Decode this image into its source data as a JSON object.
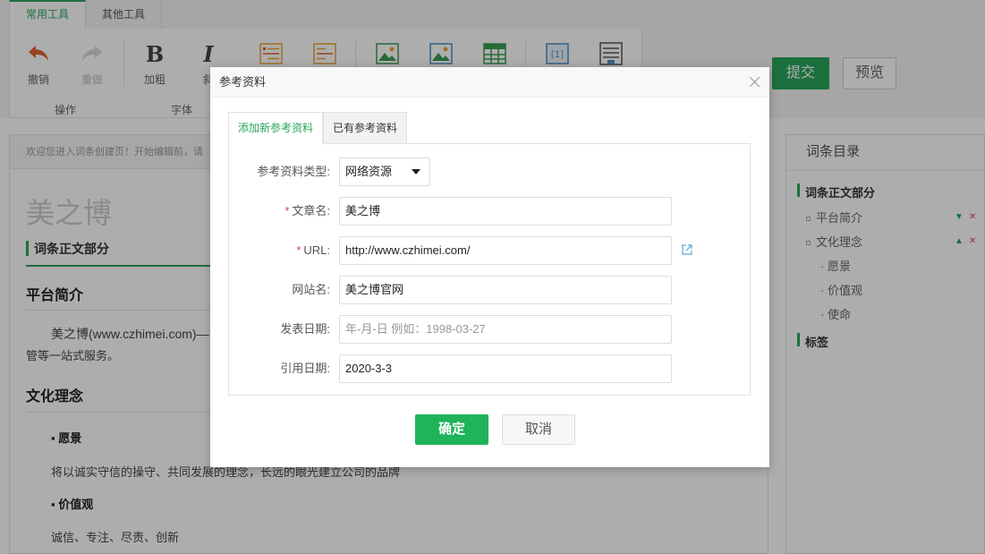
{
  "top_tabs": [
    "常用工具",
    "其他工具"
  ],
  "toolbar": {
    "undo": "撤销",
    "redo": "重做",
    "bold": "加粗",
    "italic_partial": "斜",
    "groups": {
      "operation": "操作",
      "font": "字体"
    }
  },
  "actions": {
    "submit": "提交",
    "preview": "预览"
  },
  "editor": {
    "notice": "欢迎您进入词条创建页！开始编辑前，请",
    "title": "美之博",
    "section": "词条正文部分",
    "h_platform": "平台简介",
    "platform_text_1": "美之博(www.czhimei.com)—",
    "platform_text_2": "管等一站式服务。",
    "h_culture": "文化理念",
    "sub_vision": "愿景",
    "vision_text": "将以诚实守信的操守、共同发展的理念，长远的眼光建立公司的品牌",
    "sub_values": "价值观",
    "values_text": "诚信、专注、尽责、创新"
  },
  "toc": {
    "title": "词条目录",
    "section_main": "词条正文部分",
    "items": [
      "平台简介",
      "文化理念"
    ],
    "subs": [
      "愿景",
      "价值观",
      "使命"
    ],
    "section_tags": "标签",
    "up_glyph": "▲",
    "remove_glyph": "✕"
  },
  "modal": {
    "title": "参考资料",
    "tabs": [
      "添加新参考资料",
      "已有参考资料"
    ],
    "fields": {
      "type": {
        "label": "参考资料类型:",
        "value": "网络资源"
      },
      "article": {
        "label": "文章名:",
        "value": "美之博"
      },
      "url": {
        "label": "URL:",
        "value": "http://www.czhimei.com/"
      },
      "site": {
        "label": "网站名:",
        "value": "美之博官网"
      },
      "pub_date": {
        "label": "发表日期:",
        "placeholder": "年-月-日 例如：1998-03-27"
      },
      "cite_date": {
        "label": "引用日期:",
        "value": "2020-3-3"
      }
    },
    "required_mark": "*",
    "ok": "确定",
    "cancel": "取消"
  },
  "colors": {
    "accent": "#2aa55c",
    "button_green": "#1fb35a",
    "required": "#e04040",
    "link_icon": "#5aa7d8"
  }
}
